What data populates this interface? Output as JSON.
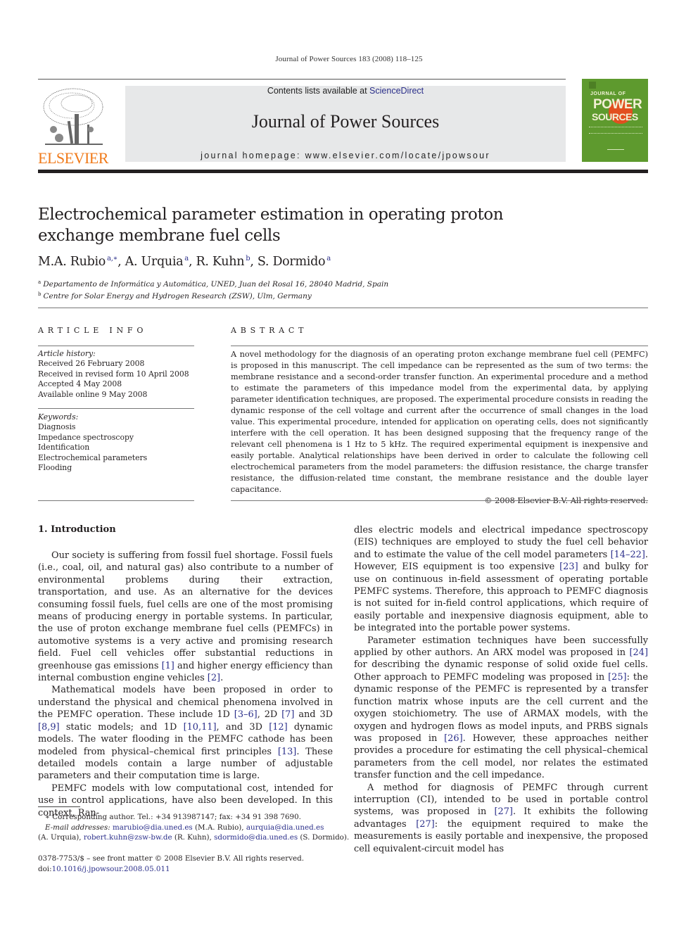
{
  "running_head": "Journal of Power Sources 183 (2008) 118–125",
  "masthead": {
    "publisher_wordmark": "ELSEVIER",
    "contents_prefix": "Contents lists available at ",
    "contents_link": "ScienceDirect",
    "journal_name": "Journal of Power Sources",
    "homepage_label": "journal homepage: ",
    "homepage_url": "www.elsevier.com/locate/jpowsour",
    "cover": {
      "line1": "JOURNAL OF",
      "line2": "POWER",
      "line3": "SOURCES"
    },
    "colors": {
      "wordmark": "#f07a1a",
      "cover_green": "#5e9a2e",
      "cover_sun": "#e24f1f",
      "masthead_bg": "#e7e8e9",
      "link": "#2b2f8a"
    }
  },
  "article": {
    "title": "Electrochemical parameter estimation in operating proton exchange membrane fuel cells",
    "authors": [
      {
        "name": "M.A. Rubio",
        "aff": "a,∗",
        "sep": ", "
      },
      {
        "name": "A. Urquia",
        "aff": "a",
        "sep": ", "
      },
      {
        "name": "R. Kuhn",
        "aff": "b",
        "sep": ", "
      },
      {
        "name": "S. Dormido",
        "aff": "a",
        "sep": ""
      }
    ],
    "affiliations": [
      {
        "mark": "a",
        "text": "Departamento de Informática y Automática, UNED, Juan del Rosal 16, 28040 Madrid, Spain"
      },
      {
        "mark": "b",
        "text": "Centre for Solar Energy and Hydrogen Research (ZSW), Ulm, Germany"
      }
    ]
  },
  "article_info": {
    "heading": "ARTICLE INFO",
    "history_label": "Article history:",
    "history": [
      "Received 26 February 2008",
      "Received in revised form 10 April 2008",
      "Accepted 4 May 2008",
      "Available online 9 May 2008"
    ],
    "keywords_label": "Keywords:",
    "keywords": [
      "Diagnosis",
      "Impedance spectroscopy",
      "Identification",
      "Electrochemical parameters",
      "Flooding"
    ]
  },
  "abstract": {
    "heading": "ABSTRACT",
    "text": "A novel methodology for the diagnosis of an operating proton exchange membrane fuel cell (PEMFC) is proposed in this manuscript. The cell impedance can be represented as the sum of two terms: the membrane resistance and a second-order transfer function. An experimental procedure and a method to estimate the parameters of this impedance model from the experimental data, by applying parameter identification techniques, are proposed. The experimental procedure consists in reading the dynamic response of the cell voltage and current after the occurrence of small changes in the load value. This experimental procedure, intended for application on operating cells, does not significantly interfere with the cell operation. It has been designed supposing that the frequency range of the relevant cell phenomena is 1 Hz to 5 kHz. The required experimental equipment is inexpensive and easily portable. Analytical relationships have been derived in order to calculate the following cell electrochemical parameters from the model parameters: the diffusion resistance, the charge transfer resistance, the diffusion-related time constant, the membrane resistance and the double layer capacitance.",
    "copyright": "© 2008 Elsevier B.V. All rights reserved."
  },
  "body": {
    "section_heading": "1.  Introduction",
    "left_paragraphs": [
      [
        {
          "t": "Our society is suffering from fossil fuel shortage. Fossil fuels (i.e., coal, oil, and natural gas) also contribute to a number of environmental problems during their extraction, transportation, and use. As an alternative for the devices consuming fossil fuels, fuel cells are one of the most promising means of producing energy in portable systems. In particular, the use of proton exchange membrane fuel cells (PEMFCs) in automotive systems is a very active and promising research field. Fuel cell vehicles offer substantial reductions in greenhouse gas emissions "
        },
        {
          "ref": "[1]"
        },
        {
          "t": " and higher energy efficiency than internal combustion engine vehicles "
        },
        {
          "ref": "[2]"
        },
        {
          "t": "."
        }
      ],
      [
        {
          "t": "Mathematical models have been proposed in order to understand the physical and chemical phenomena involved in the PEMFC operation. These include 1D "
        },
        {
          "ref": "[3–6]"
        },
        {
          "t": ", 2D "
        },
        {
          "ref": "[7]"
        },
        {
          "t": " and 3D "
        },
        {
          "ref": "[8,9]"
        },
        {
          "t": " static models; and 1D "
        },
        {
          "ref": "[10,11]"
        },
        {
          "t": ", and 3D "
        },
        {
          "ref": "[12]"
        },
        {
          "t": " dynamic models. The water flooding in the PEMFC cathode has been modeled from physical–chemical first principles "
        },
        {
          "ref": "[13]"
        },
        {
          "t": ". These detailed models contain a large number of adjustable parameters and their computation time is large."
        }
      ],
      [
        {
          "t": "PEMFC models with low computational cost, intended for use in control applications, have also been developed. In this context, Ran-"
        }
      ]
    ],
    "right_paragraphs": [
      [
        {
          "t": "dles electric models and electrical impedance spectroscopy (EIS) techniques are employed to study the fuel cell behavior and to estimate the value of the cell model parameters "
        },
        {
          "ref": "[14–22]"
        },
        {
          "t": ". However, EIS equipment is too expensive "
        },
        {
          "ref": "[23]"
        },
        {
          "t": " and bulky for use on continuous in-field assessment of operating portable PEMFC systems. Therefore, this approach to PEMFC diagnosis is not suited for in-field control applications, which require of easily portable and inexpensive diagnosis equipment, able to be integrated into the portable power systems."
        }
      ],
      [
        {
          "t": "Parameter estimation techniques have been successfully applied by other authors. An ARX model was proposed in "
        },
        {
          "ref": "[24]"
        },
        {
          "t": " for describing the dynamic response of solid oxide fuel cells. Other approach to PEMFC modeling was proposed in "
        },
        {
          "ref": "[25]"
        },
        {
          "t": ": the dynamic response of the PEMFC is represented by a transfer function matrix whose inputs are the cell current and the oxygen stoichiometry. The use of ARMAX models, with the oxygen and hydrogen flows as model inputs, and PRBS signals was proposed in "
        },
        {
          "ref": "[26]"
        },
        {
          "t": ". However, these approaches neither provides a procedure for estimating the cell physical–chemical parameters from the cell model, nor relates the estimated transfer function and the cell impedance."
        }
      ],
      [
        {
          "t": "A method for diagnosis of PEMFC through current interruption (CI), intended to be used in portable control systems, was proposed in "
        },
        {
          "ref": "[27]"
        },
        {
          "t": ". It exhibits the following advantages "
        },
        {
          "ref": "[27]"
        },
        {
          "t": ": the equipment required to make the measurements is easily portable and inexpensive, the proposed cell equivalent-circuit model has"
        }
      ]
    ]
  },
  "footnotes": {
    "corresponding": "∗ Corresponding author. Tel.: +34 913987147; fax: +34 91 398 7690.",
    "email_label": "E-mail addresses: ",
    "emails": [
      {
        "address": "marubio@dia.uned.es",
        "owner": " (M.A. Rubio), "
      },
      {
        "address": "aurquia@dia.uned.es",
        "owner": ""
      },
      {
        "address": "robert.kuhn@zsw-bw.de",
        "owner": " (R. Kuhn), "
      },
      {
        "address": "sdormido@dia.uned.es",
        "owner": " (S. Dormido)."
      }
    ],
    "urquia_owner": "(A. Urquia), ",
    "front_matter": "0378-7753/$ – see front matter © 2008 Elsevier B.V. All rights reserved.",
    "doi_label": "doi:",
    "doi": "10.1016/j.jpowsour.2008.05.011"
  }
}
